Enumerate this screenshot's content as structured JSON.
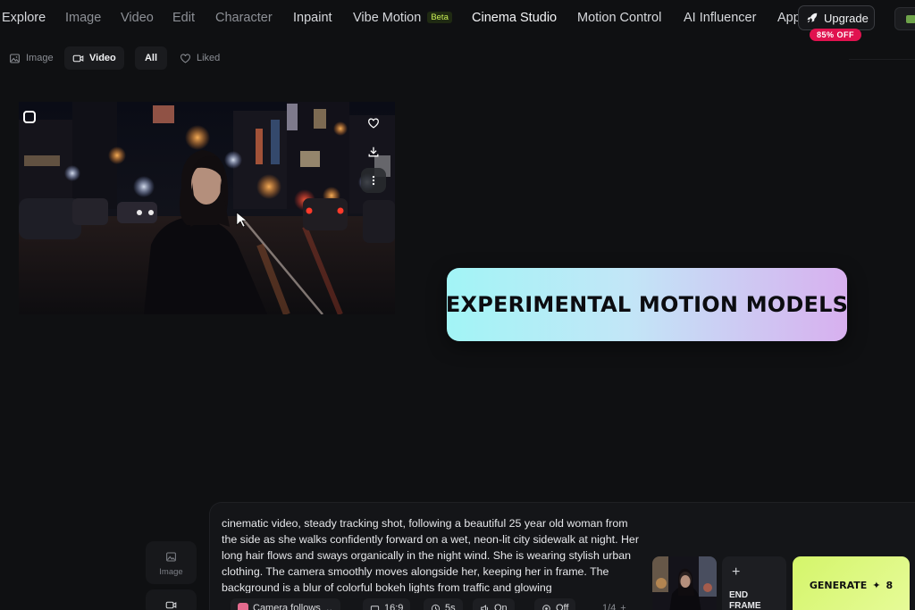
{
  "nav": {
    "items": [
      {
        "label": "Explore",
        "state": "bright"
      },
      {
        "label": "Image",
        "state": "dim"
      },
      {
        "label": "Video",
        "state": "dim"
      },
      {
        "label": "Edit",
        "state": "dim"
      },
      {
        "label": "Character",
        "state": "dim"
      },
      {
        "label": "Inpaint",
        "state": "bright"
      },
      {
        "label": "Vibe Motion",
        "state": "bright",
        "badge": "Beta"
      },
      {
        "label": "Cinema Studio",
        "state": "active"
      },
      {
        "label": "Motion Control",
        "state": "bright"
      },
      {
        "label": "AI Influencer",
        "state": "bright"
      },
      {
        "label": "Apps",
        "state": "bright"
      }
    ],
    "upgrade_label": "Upgrade",
    "discount_label": "85% OFF"
  },
  "filters": [
    {
      "label": "Image",
      "icon": "image-icon",
      "active": false
    },
    {
      "label": "Video",
      "icon": "video-icon",
      "active": true
    },
    {
      "label": "All",
      "icon": "",
      "active": true
    },
    {
      "label": "Liked",
      "icon": "heart-icon",
      "active": false
    }
  ],
  "media_card": {
    "actions": [
      "heart-icon",
      "download-icon",
      "more-vertical-icon"
    ]
  },
  "promo": {
    "text": "EXPERIMENTAL MOTION MODELS"
  },
  "composer": {
    "side_tabs": [
      {
        "label": "Image",
        "icon": "image-icon"
      },
      {
        "label": "",
        "icon": "video-icon"
      }
    ],
    "prompt": "cinematic video, steady tracking shot, following a beautiful 25 year old woman from the side as she walks confidently forward on a wet, neon-lit city sidewalk at night. Her long hair flows and sways organically in the night wind. She is wearing stylish urban clothing. The camera smoothly moves alongside her, keeping her in frame. The background is a blur of colorful bokeh lights from traffic and glowing",
    "chips": [
      {
        "label": "Camera follows",
        "icon": "preset-icon"
      },
      {
        "label": "16:9",
        "icon": "aspect-ratio-icon"
      },
      {
        "label": "5s",
        "icon": "clock-icon"
      },
      {
        "label": "On",
        "icon": "sound-icon"
      },
      {
        "label": "Off",
        "icon": "settings-icon"
      },
      {
        "label": "1/4",
        "icon": ""
      }
    ],
    "end_frame_label": "END FRAME",
    "generate_label": "GENERATE",
    "generate_cost": "8"
  },
  "colors": {
    "background": "#0f1012",
    "accent_lime": "#d4f56a",
    "discount_red": "#e0124f",
    "promo_gradient": [
      "#a2f5f6",
      "#d8b0ef"
    ]
  }
}
